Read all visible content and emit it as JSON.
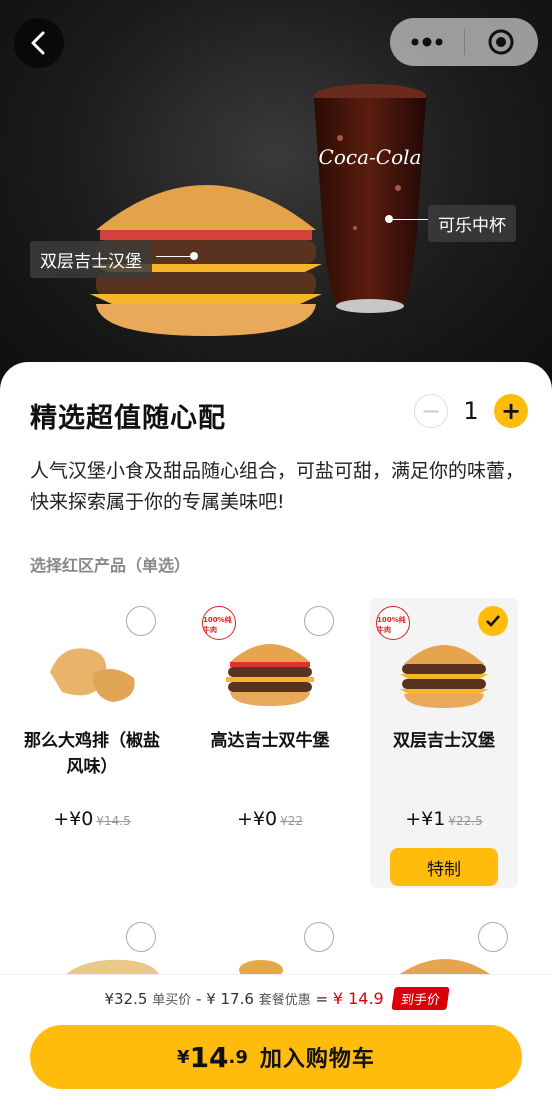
{
  "hero": {
    "tag_burger": "双层吉士汉堡",
    "tag_drink": "可乐中杯"
  },
  "product": {
    "title": "精选超值随心配",
    "quantity": "1",
    "description": "人气汉堡小食及甜品随心组合，可盐可甜，满足你的味蕾，快来探索属于你的专属美味吧!"
  },
  "section_label": "选择红区产品（单选）",
  "options": [
    {
      "name": "那么大鸡排（椒盐风味）",
      "price": "+¥0",
      "old_price": "¥14.5",
      "badge": "",
      "selected": false
    },
    {
      "name": "高达吉士双牛堡",
      "price": "+¥0",
      "old_price": "¥22",
      "badge": "100%纯牛肉",
      "selected": false
    },
    {
      "name": "双层吉士汉堡",
      "price": "+¥1",
      "old_price": "¥22.5",
      "badge": "100%纯牛肉",
      "selected": true,
      "button": "特制"
    }
  ],
  "summary": {
    "single_price": "¥32.5",
    "single_label": "单买价",
    "minus": "-",
    "discount": "¥ 17.6",
    "discount_label": "套餐优惠",
    "equals": "=",
    "final": "¥ 14.9",
    "final_tag": "到手价"
  },
  "cta": {
    "currency": "¥",
    "amount": "14",
    "decimal": ".9",
    "label": "加入购物车"
  },
  "colors": {
    "accent": "#ffbc0d",
    "red": "#d90007"
  }
}
